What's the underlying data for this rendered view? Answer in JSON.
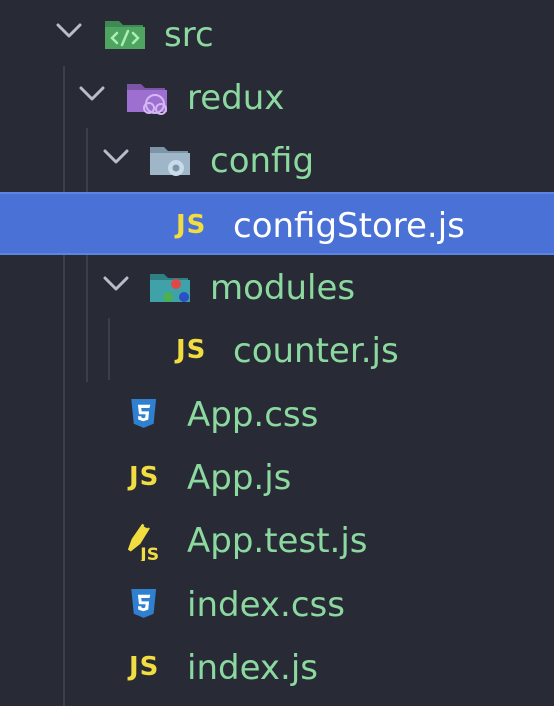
{
  "tree": {
    "src": "src",
    "redux": "redux",
    "config": "config",
    "configStore": "configStore.js",
    "modules": "modules",
    "counter": "counter.js",
    "app_css": "App.css",
    "app_js": "App.js",
    "app_test": "App.test.js",
    "index_css": "index.css",
    "index_js": "index.js"
  },
  "js_badge_text": "JS",
  "colors": {
    "background": "#282a36",
    "label": "#8cd9a0",
    "selected_background": "#4a72d6",
    "selected_label": "#ffffff",
    "js_badge": "#f1dd3f",
    "css_icon": "#2f80d1",
    "folder_src": "#4fa461",
    "folder_redux": "#9d6fd1",
    "folder_config": "#9fb6c8",
    "folder_modules": "#3fa2a8"
  },
  "icons": {
    "src": "folder-src-icon",
    "redux": "folder-redux-icon",
    "config": "folder-config-icon",
    "modules": "folder-modules-icon",
    "js": "javascript-file-icon",
    "css": "css-file-icon",
    "test": "test-file-icon"
  }
}
